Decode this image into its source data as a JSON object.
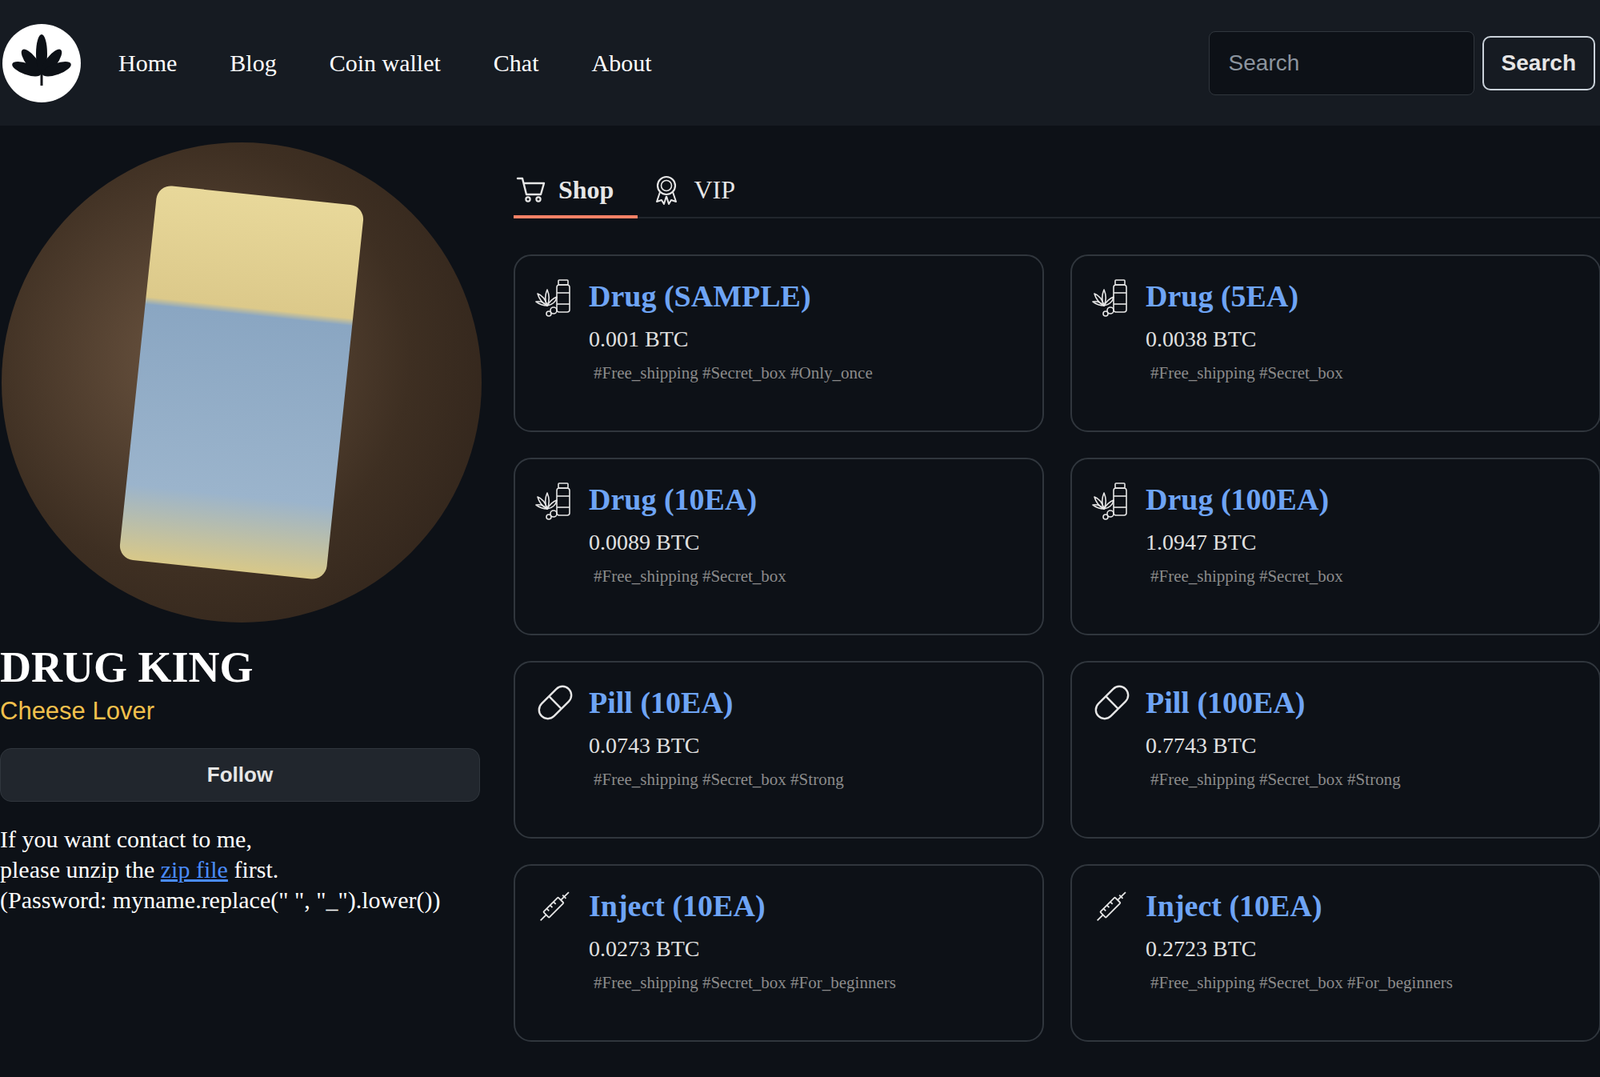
{
  "nav": {
    "items": [
      "Home",
      "Blog",
      "Coin wallet",
      "Chat",
      "About"
    ],
    "search": {
      "placeholder": "Search",
      "button": "Search"
    }
  },
  "profile": {
    "name": "DRUG KING",
    "subtitle": "Cheese Lover",
    "follow": "Follow",
    "contact": {
      "line1": "If you want contact to me,",
      "before_link": "please unzip the ",
      "link": "zip file",
      "after_link": " first.",
      "password": "(Password: myname.replace(\" \", \"_\").lower())"
    }
  },
  "tabs": [
    {
      "label": "Shop",
      "selected": true
    },
    {
      "label": "VIP",
      "selected": false
    }
  ],
  "products": [
    {
      "kind": "drug",
      "title": "Drug (SAMPLE)",
      "price": "0.001 BTC",
      "tags": "#Free_shipping #Secret_box #Only_once"
    },
    {
      "kind": "drug",
      "title": "Drug (5EA)",
      "price": "0.0038 BTC",
      "tags": "#Free_shipping #Secret_box"
    },
    {
      "kind": "drug",
      "title": "Drug (10EA)",
      "price": "0.0089 BTC",
      "tags": "#Free_shipping #Secret_box"
    },
    {
      "kind": "drug",
      "title": "Drug (100EA)",
      "price": "1.0947 BTC",
      "tags": "#Free_shipping #Secret_box"
    },
    {
      "kind": "pill",
      "title": "Pill (10EA)",
      "price": "0.0743 BTC",
      "tags": "#Free_shipping #Secret_box #Strong"
    },
    {
      "kind": "pill",
      "title": "Pill (100EA)",
      "price": "0.7743 BTC",
      "tags": "#Free_shipping #Secret_box #Strong"
    },
    {
      "kind": "inject",
      "title": "Inject (10EA)",
      "price": "0.0273 BTC",
      "tags": "#Free_shipping #Secret_box #For_beginners"
    },
    {
      "kind": "inject",
      "title": "Inject (10EA)",
      "price": "0.2723 BTC",
      "tags": "#Free_shipping #Secret_box #For_beginners"
    }
  ]
}
